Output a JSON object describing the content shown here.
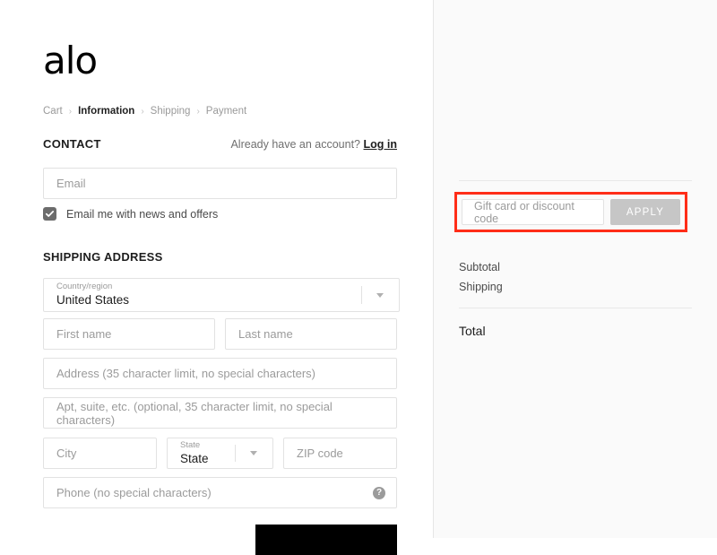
{
  "brand": {
    "logo_text": "alo"
  },
  "breadcrumb": {
    "items": [
      {
        "label": "Cart",
        "active": false
      },
      {
        "label": "Information",
        "active": true
      },
      {
        "label": "Shipping",
        "active": false
      },
      {
        "label": "Payment",
        "active": false
      }
    ],
    "separator": "›"
  },
  "contact": {
    "section_title": "CONTACT",
    "account_prompt": "Already have an account?",
    "login_label": "Log in",
    "email_placeholder": "Email",
    "email_value": "",
    "newsletter_label": "Email me with news and offers",
    "newsletter_checked": true
  },
  "shipping": {
    "section_title": "SHIPPING ADDRESS",
    "country": {
      "label": "Country/region",
      "value": "United States"
    },
    "first_name_placeholder": "First name",
    "first_name_value": "",
    "last_name_placeholder": "Last name",
    "last_name_value": "",
    "address_placeholder": "Address (35 character limit, no special characters)",
    "address_value": "",
    "apt_placeholder": "Apt, suite, etc. (optional, 35 character limit, no special characters)",
    "apt_value": "",
    "city_placeholder": "City",
    "city_value": "",
    "state": {
      "label": "State",
      "value": "State"
    },
    "zip_placeholder": "ZIP code",
    "zip_value": "",
    "phone_placeholder": "Phone (no special characters)",
    "phone_value": "",
    "phone_help_icon": "question-mark-icon"
  },
  "summary": {
    "gift_card_placeholder": "Gift card or discount code",
    "gift_card_value": "",
    "apply_label": "APPLY",
    "subtotal_label": "Subtotal",
    "subtotal_value": "",
    "shipping_label": "Shipping",
    "shipping_value": "",
    "total_label": "Total",
    "total_value": ""
  },
  "footer": {
    "continue_label": ""
  },
  "colors": {
    "accent_highlight": "#ff2d18",
    "panel_background": "#fafafa",
    "page_background": "#ffffff",
    "button_black": "#000000",
    "apply_button": "#c6c6c6",
    "checkbox_fill": "#6c6c6c"
  }
}
